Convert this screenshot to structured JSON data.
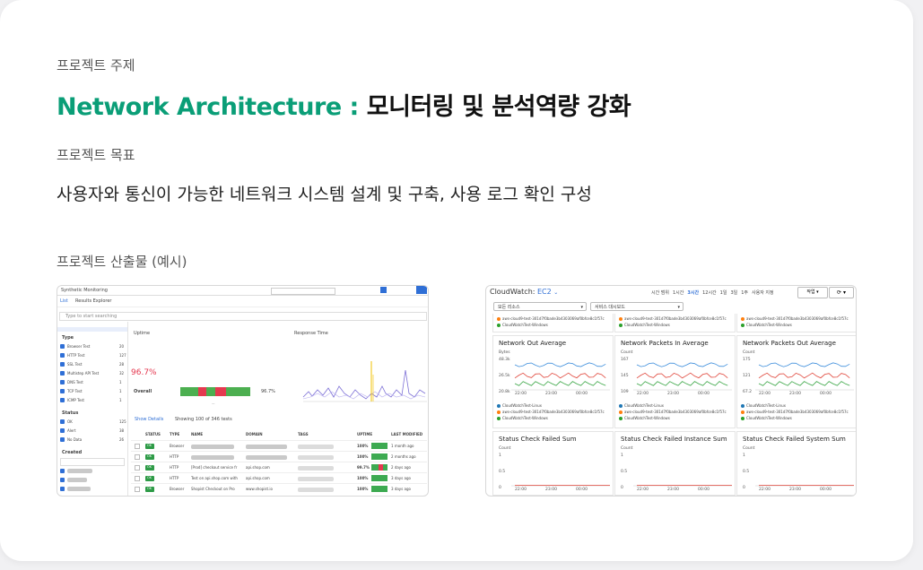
{
  "labels": {
    "subject": "프로젝트 주제",
    "goal": "프로젝트 목표",
    "output": "프로젝트 산출물 (예시)"
  },
  "title": {
    "accent": "Network Architecture :",
    "rest": " 모니터링 및 분석역량 강화"
  },
  "goal_text": "사용자와 통신이 가능한 네트워크 시스템 설계 및 구축, 사용 로그 확인 구성",
  "colors": {
    "accent": "#0a9e77",
    "error": "#e53950",
    "ok": "#4caf50"
  },
  "synthetics": {
    "window_title": "Synthetic Monitoring",
    "tab_list": "List",
    "tab_explorer": "Results Explorer",
    "search_placeholder": "Type to start searching",
    "filter_type_label": "Type",
    "filter_status_label": "Status",
    "filter_created_label": "Created",
    "types": [
      {
        "name": "Browser Test",
        "count": "20"
      },
      {
        "name": "HTTP Test",
        "count": "127"
      },
      {
        "name": "SSL Test",
        "count": "28"
      },
      {
        "name": "Multistep API Test",
        "count": "32"
      },
      {
        "name": "DNS Test",
        "count": "1"
      },
      {
        "name": "TCP Test",
        "count": "1"
      },
      {
        "name": "ICMP Test",
        "count": "1"
      }
    ],
    "statuses": [
      {
        "name": "OK",
        "count": "125"
      },
      {
        "name": "Alert",
        "count": "38"
      },
      {
        "name": "No Data",
        "count": "26"
      }
    ],
    "uptime_label": "Uptime",
    "uptime_value": "96.7%",
    "overall_label": "Overall",
    "overall_value": "96.7%",
    "response_label": "Response Time",
    "show_details": "Show Details",
    "showing": "Showing 100 of 346 tests",
    "columns": [
      "STATUS",
      "TYPE",
      "NAME",
      "DOMAIN",
      "TAGS",
      "UPTIME",
      "LAST MODIFIED"
    ],
    "rows": [
      {
        "status": "OK",
        "type": "Browser",
        "uptime": "100%",
        "modified": "1 month ago"
      },
      {
        "status": "OK",
        "type": "HTTP",
        "uptime": "100%",
        "modified": "2 months ago"
      },
      {
        "status": "OK",
        "type": "HTTP",
        "name": "[Prod] checkout service fr",
        "domain": "api.shop.com",
        "uptime": "99.7%",
        "modified": "2 days ago"
      },
      {
        "status": "OK",
        "type": "HTTP",
        "name": "Test on api.shop.com with",
        "domain": "api.shop.com",
        "uptime": "100%",
        "modified": "3 days ago"
      },
      {
        "status": "OK",
        "type": "Browser",
        "name": "Shopist Checkout on Pro",
        "domain": "www.shopist.io",
        "uptime": "100%",
        "modified": "3 days ago"
      }
    ]
  },
  "cloudwatch": {
    "title_prefix": "CloudWatch:",
    "title_service": "EC2",
    "time_label": "시간 범위",
    "time_options": [
      "1시간",
      "3시간",
      "12시간",
      "1일",
      "3일",
      "1주",
      "사용자 지정"
    ],
    "actions_label": "작업",
    "select_resources": "모든 리소스",
    "select_metric": "서비스 대시보드",
    "top_legends": [
      {
        "text": "aws-cloud9-test-301d7f0bade3b4303069af0bfce8c1f57c",
        "color": "#ff7f0e"
      },
      {
        "text": "CloudWatchTest-Windows",
        "color": "#2ca02c"
      }
    ],
    "tiles": [
      {
        "title": "Network Out Average",
        "unit": "Bytes",
        "y": [
          "48.3k",
          "26.5k",
          "20.8k"
        ],
        "x": [
          "22:00",
          "23:00",
          "00:00"
        ]
      },
      {
        "title": "Network Packets In Average",
        "unit": "Count",
        "y": [
          "167",
          "145",
          "109"
        ],
        "x": [
          "22:00",
          "23:00",
          "00:00"
        ]
      },
      {
        "title": "Network Packets Out Average",
        "unit": "Count",
        "y": [
          "175",
          "121",
          "67.2"
        ],
        "x": [
          "22:00",
          "23:00",
          "00:00"
        ]
      },
      {
        "title": "Status Check Failed Sum",
        "unit": "Count",
        "y": [
          "1",
          "0.5",
          "0"
        ],
        "x": [
          "22:00",
          "23:00",
          "00:00"
        ]
      },
      {
        "title": "Status Check Failed Instance Sum",
        "unit": "Count",
        "y": [
          "1",
          "0.5",
          "0"
        ],
        "x": [
          "22:00",
          "23:00",
          "00:00"
        ]
      },
      {
        "title": "Status Check Failed System Sum",
        "unit": "Count",
        "y": [
          "1",
          "0.5",
          "0"
        ],
        "x": [
          "22:00",
          "23:00",
          "00:00"
        ]
      }
    ],
    "legend_linux": "CloudWatchTest-Linux",
    "legend_cloud9": "aws-cloud9-test-301d7f0bade3b4303069af0bfce8c1f57c",
    "legend_windows": "CloudWatchTest-Windows"
  }
}
